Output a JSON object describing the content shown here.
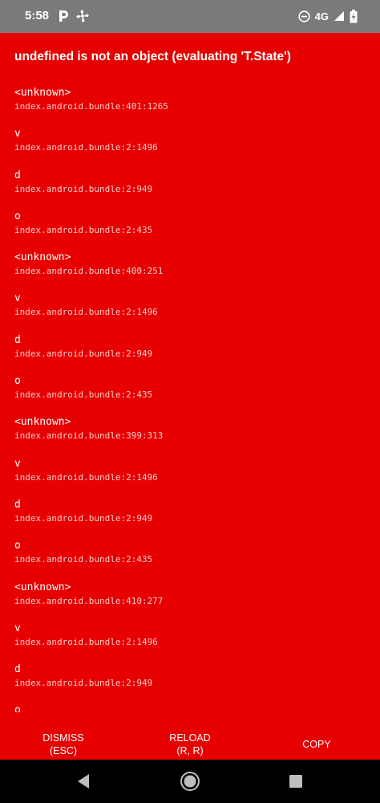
{
  "status_bar": {
    "time": "5:58",
    "network": "4G",
    "left_icons": [
      "parking-icon",
      "fan-icon"
    ],
    "right_icons": [
      "do-not-disturb-icon",
      "signal-icon",
      "battery-charging-icon"
    ]
  },
  "error": {
    "title": "undefined is not an object (evaluating 'T.State')",
    "stack": [
      {
        "method": "<unknown>",
        "location": "index.android.bundle:401:1265"
      },
      {
        "method": "v",
        "location": "index.android.bundle:2:1496"
      },
      {
        "method": "d",
        "location": "index.android.bundle:2:949"
      },
      {
        "method": "o",
        "location": "index.android.bundle:2:435"
      },
      {
        "method": "<unknown>",
        "location": "index.android.bundle:400:251"
      },
      {
        "method": "v",
        "location": "index.android.bundle:2:1496"
      },
      {
        "method": "d",
        "location": "index.android.bundle:2:949"
      },
      {
        "method": "o",
        "location": "index.android.bundle:2:435"
      },
      {
        "method": "<unknown>",
        "location": "index.android.bundle:399:313"
      },
      {
        "method": "v",
        "location": "index.android.bundle:2:1496"
      },
      {
        "method": "d",
        "location": "index.android.bundle:2:949"
      },
      {
        "method": "o",
        "location": "index.android.bundle:2:435"
      },
      {
        "method": "<unknown>",
        "location": "index.android.bundle:410:277"
      },
      {
        "method": "v",
        "location": "index.android.bundle:2:1496"
      },
      {
        "method": "d",
        "location": "index.android.bundle:2:949"
      },
      {
        "method": "o",
        "location": ""
      }
    ],
    "buttons": {
      "dismiss_line1": "DISMISS",
      "dismiss_line2": "(ESC)",
      "reload_line1": "RELOAD",
      "reload_line2": "(R, R)",
      "copy": "COPY"
    }
  },
  "colors": {
    "error_background": "#e60000",
    "status_bar": "#7a7a7a",
    "nav_bar": "#000000",
    "text": "#ffffff"
  },
  "nav_bar": {
    "icons": [
      "back-icon",
      "home-icon",
      "recents-icon"
    ]
  }
}
